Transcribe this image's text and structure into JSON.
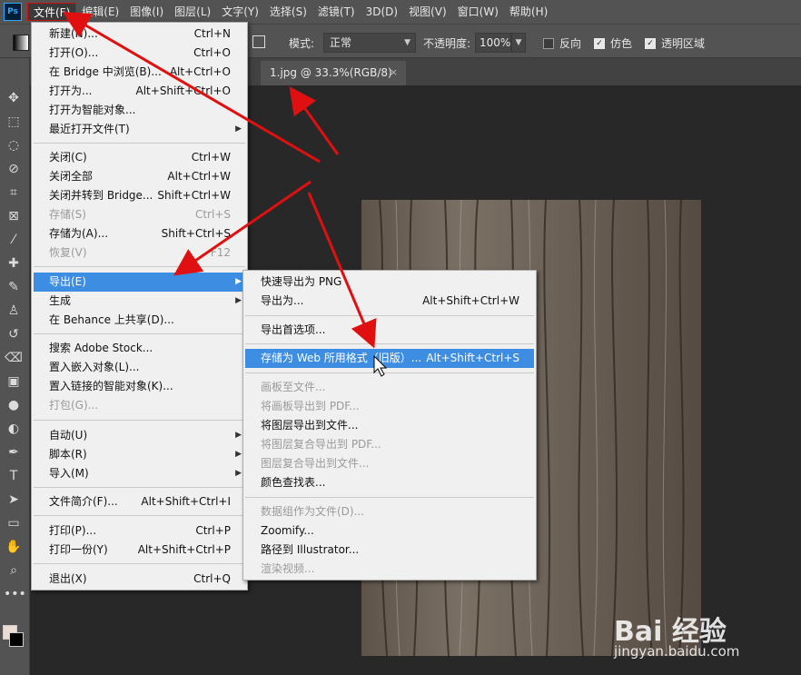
{
  "app": {
    "logo": "Ps"
  },
  "menubar": [
    "文件(F)",
    "编辑(E)",
    "图像(I)",
    "图层(L)",
    "文字(Y)",
    "选择(S)",
    "滤镜(T)",
    "3D(D)",
    "视图(V)",
    "窗口(W)",
    "帮助(H)"
  ],
  "options": {
    "mode_label": "模式:",
    "mode_value": "正常",
    "opacity_label": "不透明度:",
    "opacity_value": "100%",
    "reverse_label": "反向",
    "reverse_checked": false,
    "dither_label": "仿色",
    "dither_checked": true,
    "transparency_label": "透明区域",
    "transparency_checked": true
  },
  "document_tab": {
    "title": "1.jpg @ 33.3%(RGB/8)",
    "close": "×"
  },
  "file_menu": {
    "items": [
      {
        "label": "新建(N)...",
        "shortcut": "Ctrl+N"
      },
      {
        "label": "打开(O)...",
        "shortcut": "Ctrl+O"
      },
      {
        "label": "在 Bridge 中浏览(B)...",
        "shortcut": "Alt+Ctrl+O"
      },
      {
        "label": "打开为...",
        "shortcut": "Alt+Shift+Ctrl+O"
      },
      {
        "label": "打开为智能对象...",
        "shortcut": ""
      },
      {
        "label": "最近打开文件(T)",
        "shortcut": "",
        "submenu": true
      },
      {
        "label": "关闭(C)",
        "shortcut": "Ctrl+W"
      },
      {
        "label": "关闭全部",
        "shortcut": "Alt+Ctrl+W"
      },
      {
        "label": "关闭并转到 Bridge...",
        "shortcut": "Shift+Ctrl+W"
      },
      {
        "label": "存储(S)",
        "shortcut": "Ctrl+S",
        "disabled": true
      },
      {
        "label": "存储为(A)...",
        "shortcut": "Shift+Ctrl+S"
      },
      {
        "label": "恢复(V)",
        "shortcut": "F12",
        "disabled": true
      },
      {
        "label": "导出(E)",
        "shortcut": "",
        "submenu": true,
        "highlighted": true
      },
      {
        "label": "生成",
        "shortcut": "",
        "submenu": true
      },
      {
        "label": "在 Behance 上共享(D)...",
        "shortcut": ""
      },
      {
        "label": "搜索 Adobe Stock...",
        "shortcut": ""
      },
      {
        "label": "置入嵌入对象(L)...",
        "shortcut": ""
      },
      {
        "label": "置入链接的智能对象(K)...",
        "shortcut": ""
      },
      {
        "label": "打包(G)...",
        "shortcut": "",
        "disabled": true
      },
      {
        "label": "自动(U)",
        "shortcut": "",
        "submenu": true
      },
      {
        "label": "脚本(R)",
        "shortcut": "",
        "submenu": true
      },
      {
        "label": "导入(M)",
        "shortcut": "",
        "submenu": true
      },
      {
        "label": "文件简介(F)...",
        "shortcut": "Alt+Shift+Ctrl+I"
      },
      {
        "label": "打印(P)...",
        "shortcut": "Ctrl+P"
      },
      {
        "label": "打印一份(Y)",
        "shortcut": "Alt+Shift+Ctrl+P"
      },
      {
        "label": "退出(X)",
        "shortcut": "Ctrl+Q"
      }
    ]
  },
  "export_menu": {
    "items": [
      {
        "label": "快速导出为 PNG",
        "shortcut": ""
      },
      {
        "label": "导出为...",
        "shortcut": "Alt+Shift+Ctrl+W"
      },
      {
        "label": "导出首选项...",
        "shortcut": ""
      },
      {
        "label": "存储为 Web 所用格式（旧版）...",
        "shortcut": "Alt+Shift+Ctrl+S",
        "highlighted": true
      },
      {
        "label": "画板至文件...",
        "shortcut": "",
        "disabled": true
      },
      {
        "label": "将画板导出到 PDF...",
        "shortcut": "",
        "disabled": true
      },
      {
        "label": "将图层导出到文件...",
        "shortcut": ""
      },
      {
        "label": "将图层复合导出到 PDF...",
        "shortcut": "",
        "disabled": true
      },
      {
        "label": "图层复合导出到文件...",
        "shortcut": "",
        "disabled": true
      },
      {
        "label": "颜色查找表...",
        "shortcut": ""
      },
      {
        "label": "数据组作为文件(D)...",
        "shortcut": "",
        "disabled": true
      },
      {
        "label": "Zoomify...",
        "shortcut": ""
      },
      {
        "label": "路径到 Illustrator...",
        "shortcut": ""
      },
      {
        "label": "渲染视频...",
        "shortcut": "",
        "disabled": true
      }
    ]
  },
  "colors": {
    "annotation_arrow": "#e01010",
    "menu_highlight": "#3d8ee3"
  },
  "watermark": {
    "main": "Bai 经验",
    "sub": "jingyan.baidu.com"
  }
}
